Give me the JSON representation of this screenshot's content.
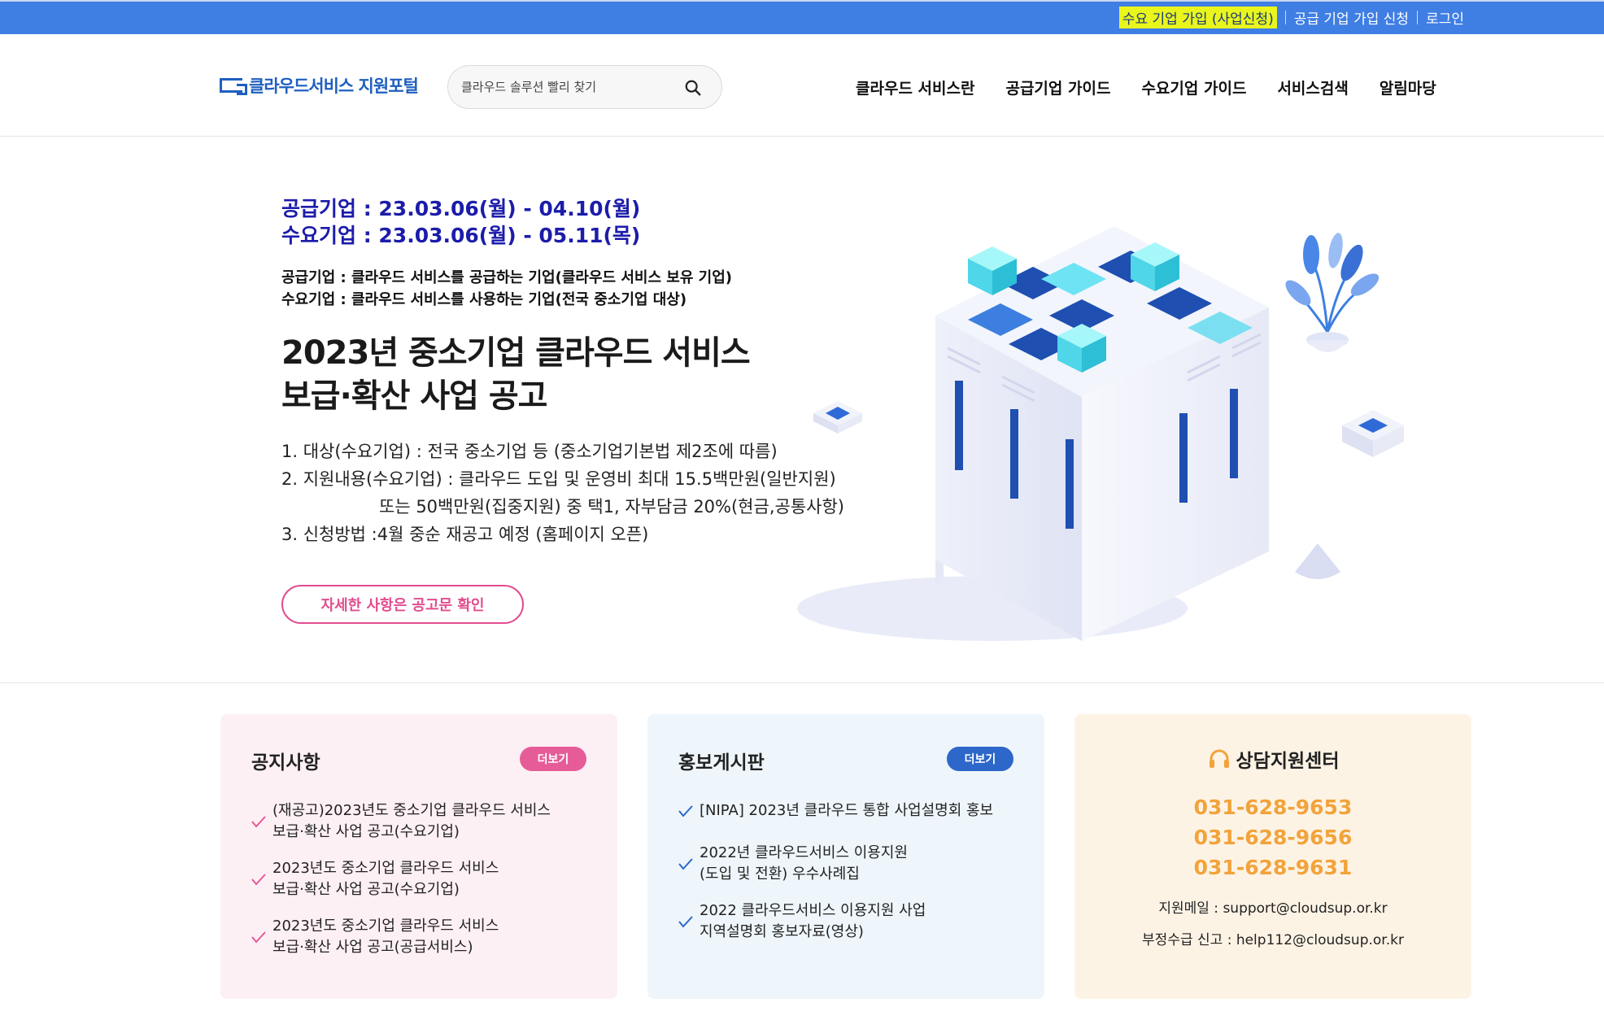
{
  "topbar": {
    "demand_signup": "수요 기업 가입 (사업신청)",
    "supply_signup": "공급 기업 가입 신청",
    "login": "로그인"
  },
  "header": {
    "logo_text": "클라우드서비스 지원포털",
    "search_placeholder": "클라우드 솔루션 빨리 찾기",
    "nav": [
      "클라우드 서비스란",
      "공급기업 가이드",
      "수요기업 가이드",
      "서비스검색",
      "알림마당"
    ]
  },
  "hero": {
    "period_supply": "공급기업 : 23.03.06(월) - 04.10(월)",
    "period_demand": "수요기업 : 23.03.06(월) - 05.11(목)",
    "def_supply": "공급기업 : 클라우드 서비스를 공급하는 기업(클라우드 서비스 보유 기업)",
    "def_demand": "수요기업 : 클라우드 서비스를 사용하는 기업(전국 중소기업 대상)",
    "headline_line1": "2023년 중소기업 클라우드 서비스",
    "headline_line2": "보급·확산 사업 공고",
    "point1": "1. 대상(수요기업) : 전국 중소기업 등 (중소기업기본법 제2조에 따름)",
    "point2": "2. 지원내용(수요기업) : 클라우드 도입 및 운영비 최대 15.5백만원(일반지원)",
    "point2_cont": "또는 50백만원(집중지원) 중 택1, 자부담금 20%(현금,공통사항)",
    "point3": "3. 신청방법 :4월 중순 재공고 예정 (홈페이지 오픈)",
    "cta": "자세한 사항은 공고문 확인"
  },
  "notice": {
    "title": "공지사항",
    "more": "더보기",
    "items": [
      {
        "line1": "(재공고)2023년도 중소기업 클라우드 서비스",
        "line2": "보급·확산 사업 공고(수요기업)"
      },
      {
        "line1": "2023년도 중소기업 클라우드 서비스",
        "line2": "보급·확산 사업 공고(수요기업)"
      },
      {
        "line1": "2023년도 중소기업 클라우드 서비스",
        "line2": "보급·확산 사업 공고(공급서비스)"
      }
    ]
  },
  "promo": {
    "title": "홍보게시판",
    "more": "더보기",
    "items": [
      {
        "line1": "[NIPA] 2023년 클라우드 통합 사업설명회 홍보",
        "line2": ""
      },
      {
        "line1": "2022년 클라우드서비스 이용지원",
        "line2": "(도입 및 전환) 우수사례집"
      },
      {
        "line1": "2022 클라우드서비스 이용지원 사업",
        "line2": "지역설명회 홍보자료(영상)"
      }
    ]
  },
  "support": {
    "title": "상담지원센터",
    "phones": [
      "031-628-9653",
      "031-628-9656",
      "031-628-9631"
    ],
    "email": "지원메일 : support@cloudsup.or.kr",
    "report": "부정수급 신고 : help112@cloudsup.or.kr"
  },
  "colors": {
    "topbar": "#3f7ee3",
    "highlight": "#e9f51c",
    "period_text": "#1c1caa",
    "cta": "#e24d8f",
    "notice_bg": "#fdf0f5",
    "promo_bg": "#eef6fb",
    "support_bg": "#fdf3e5",
    "phone_text": "#f2a33a"
  },
  "icons": {
    "search": "search-icon",
    "check": "check-icon",
    "headset": "headset-icon"
  }
}
